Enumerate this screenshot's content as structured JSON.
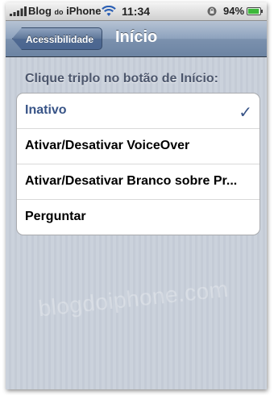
{
  "status_bar": {
    "carrier": "Blog",
    "carrier_small": "do",
    "carrier_suffix": "iPhone",
    "time": "11:34",
    "battery_percent": "94%",
    "battery_level": 0.94,
    "icons": [
      "signal-bars-icon",
      "wifi-icon",
      "rotation-lock-icon",
      "battery-icon"
    ]
  },
  "nav_bar": {
    "back_label": "Acessibilidade",
    "title": "Início"
  },
  "section": {
    "header": "Clique triplo no botão de Início:"
  },
  "options": [
    {
      "label": "Inativo",
      "selected": true
    },
    {
      "label": "Ativar/Desativar VoiceOver",
      "selected": false
    },
    {
      "label": "Ativar/Desativar Branco sobre Pr...",
      "selected": false
    },
    {
      "label": "Perguntar",
      "selected": false
    }
  ],
  "checkmark_glyph": "✓",
  "watermark": "blogdoiphone.com",
  "colors": {
    "nav_bar": "#8da2bd",
    "selected_text": "#385487",
    "background": "#c8cfd9"
  }
}
